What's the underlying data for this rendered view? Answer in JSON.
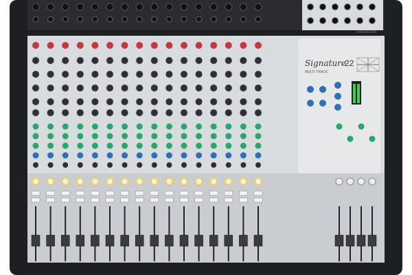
{
  "product": {
    "model_script": "Signature",
    "model_number": "22",
    "model_subtitle": "MULTI-TRACK",
    "brand_mark": "Soundcraft",
    "channel_strips_mono": 16,
    "stereo_strips": 4
  },
  "colors": {
    "chassis": "#1d1f22",
    "panel": "#d9dcdf",
    "panel_shadow": "#aeb2b6",
    "fader_bed": "#c9ccd0",
    "gain_knob": "#c23a3f",
    "eq_knob": "#2f2f33",
    "aux_knob": "#26a86a",
    "pan_knob": "#2f6fb5",
    "led_green": "#3ecf4e",
    "led_yellow": "#e8d34a",
    "fader_cap": "#3a3c40"
  }
}
